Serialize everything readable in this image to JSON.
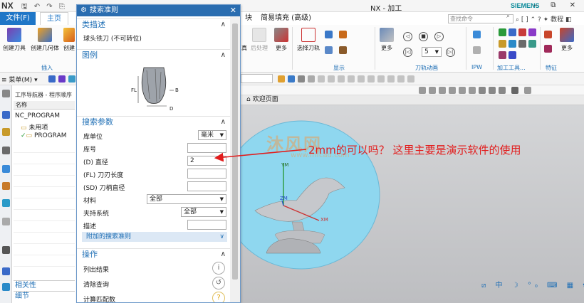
{
  "titlebar": {
    "logo": "NX",
    "title": "NX - 加工",
    "brand": "SIEMENS",
    "window_controls": "–  ⧉  ✕"
  },
  "tabs": {
    "file": "文件(F)",
    "home": "主页",
    "tab_partial": "块",
    "tab_simple_fill": "简易填充 (高级)",
    "search_placeholder": "查找命令",
    "right_tools": "⌕ [ ] ⌃ ? ✦ 教程 ◧",
    "help_label": "教程"
  },
  "ribbon": {
    "create_tool": "创建刀具",
    "create_geometry": "创建几何体",
    "create_more": "创建",
    "insert_group": "插入",
    "pp_partial": "真",
    "postprocess": "后处理",
    "more1": "更多",
    "select_tool": "选择刀轨",
    "display_group": "显示",
    "more2": "更多",
    "speed_value": "5",
    "toolpath_anim_group": "刀轨动画",
    "ipw_group": "IPW",
    "machining_tools_group": "加工工具...",
    "feature_group": "特征",
    "more3": "更多"
  },
  "toolbar": {
    "menu": "菜单(M)"
  },
  "navigator": {
    "title": "工序导航器 - 程序顺序",
    "col_name": "名称",
    "root": "NC_PROGRAM",
    "unused": "未用项",
    "program": "PROGRAM",
    "related": "相关性",
    "details": "细节"
  },
  "dialog": {
    "title": "搜索准则",
    "sec_class_desc": "类描述",
    "class_desc_value": "球头铣刀 (不可转位)",
    "sec_diagram": "图例",
    "fig_label_fl": "FL",
    "fig_label_b": "B",
    "fig_label_d": "D",
    "sec_search_params": "搜索参数",
    "lbl_lib_unit": "库单位",
    "lib_unit_value": "毫米",
    "lbl_lib_number": "库号",
    "lib_number_value": "",
    "lbl_diameter": "(D) 直径",
    "diameter_value": "2",
    "lbl_flute_length": "(FL) 刀刃长度",
    "flute_length_value": "",
    "lbl_shank_dia": "(SD) 刀柄直径",
    "shank_dia_value": "",
    "lbl_material": "材料",
    "material_value": "全部",
    "lbl_holder": "夹持系统",
    "holder_value": "全部",
    "lbl_desc": "描述",
    "desc_value": "",
    "adv_criteria": "附加的搜索准则",
    "sec_operation": "操作",
    "op_list": "列出结果",
    "op_clear": "清除查询",
    "op_count": "计算匹配数"
  },
  "viewport": {
    "tab_label": "欢迎页面",
    "watermark_title": "沐风网",
    "watermark_url": "www.mfcad.com",
    "annotation": "2mm的可以吗？    这里主要是演示软件的使用",
    "axis_ym": "YM",
    "axis_zm": "ZM",
    "axis_xm": "XM",
    "status_icons": "⧄ 中 ☽ °₀ ⌨ ▦ ✿"
  },
  "colors": {
    "accent": "#1f76c7",
    "dialog_header": "#2a6db0",
    "annotation": "#e21c1c",
    "part_fill": "#8fd7ef"
  }
}
